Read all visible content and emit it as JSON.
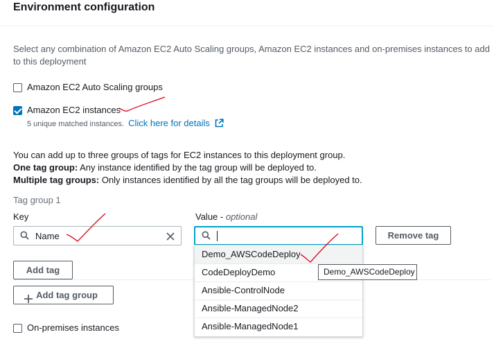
{
  "section": {
    "title": "Environment configuration"
  },
  "description": "Select any combination of Amazon EC2 Auto Scaling groups, Amazon EC2 instances and on-premises instances to add to this deployment",
  "options": {
    "autoscaling": {
      "label": "Amazon EC2 Auto Scaling groups",
      "checked": false
    },
    "ec2": {
      "label": "Amazon EC2 instances",
      "checked": true
    },
    "onprem": {
      "label": "On-premises instances",
      "checked": false
    }
  },
  "matched": {
    "text": "5 unique matched instances.",
    "link": "Click here for details"
  },
  "tags_info": {
    "line1": "You can add up to three groups of tags for EC2 instances to this deployment group.",
    "one_bold": "One tag group:",
    "one_text": " Any instance identified by the tag group will be deployed to.",
    "multi_bold": "Multiple tag groups:",
    "multi_text": " Only instances identified by all the tag groups will be deployed to."
  },
  "tag_group": {
    "title": "Tag group 1",
    "key_label": "Key",
    "key_value": "Name",
    "value_label": "Value - ",
    "value_optional": "optional",
    "value_text": "",
    "remove_label": "Remove tag",
    "add_tag_label": "Add tag",
    "add_group_label": "Add tag group"
  },
  "suggestions": [
    "Demo_AWSCodeDeploy",
    "CodeDeployDemo",
    "Ansible-ControlNode",
    "Ansible-ManagedNode2",
    "Ansible-ManagedNode1"
  ],
  "tooltip": "Demo_AWSCodeDeploy",
  "colors": {
    "accent": "#0073bb",
    "focus": "#00a1c9",
    "annotation": "#e0001b"
  },
  "icons": [
    "search-icon",
    "clear-icon",
    "external-link-icon",
    "plus-icon"
  ]
}
